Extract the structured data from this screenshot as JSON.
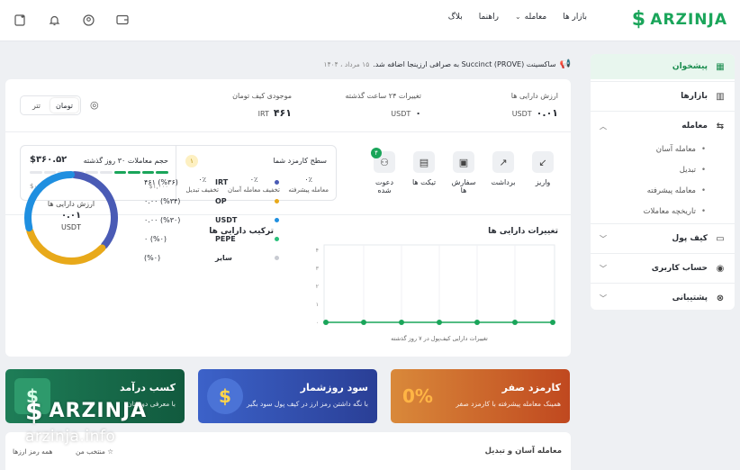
{
  "brand": {
    "name": "ARZINJA",
    "mark": "$",
    "color": "#1aa55a"
  },
  "topnav": {
    "markets": "بازار ها",
    "trade": "معامله",
    "guide": "راهنما",
    "blog": "بلاگ"
  },
  "sidebar": {
    "items": [
      {
        "label": "پیشخوان",
        "icon": "dashboard-icon"
      },
      {
        "label": "بازارها",
        "icon": "chart-bars-icon"
      },
      {
        "label": "معامله",
        "icon": "exchange-icon"
      },
      {
        "label": "کیف پول",
        "icon": "wallet-icon"
      },
      {
        "label": "حساب کاربری",
        "icon": "user-icon"
      },
      {
        "label": "پشتیبانی",
        "icon": "support-icon"
      }
    ],
    "trade_sub": [
      "معامله آسان",
      "تبدیل",
      "معامله پیشرفته",
      "تاریخچه معاملات"
    ]
  },
  "announcement": {
    "text": "ساکسینت (Succinct (PROVE به صرافی ارزینجا اضافه شد.",
    "date": "۱۵ مرداد ، ۱۴۰۴"
  },
  "stats": {
    "asset_value": {
      "label": "ارزش دارایی ها",
      "value": "۰.۰۱",
      "unit": "USDT"
    },
    "change_24h": {
      "label": "تغییرات ۲۴ ساعت گذشته",
      "value": "۰",
      "unit": "USDT"
    },
    "wallet_stock": {
      "label": "موجودی کیف تومان",
      "value": "۴۶۱",
      "unit": "IRT"
    }
  },
  "currency_toggle": {
    "toman": "تومان",
    "tether": "تتر"
  },
  "actions": [
    {
      "label": "واریز",
      "icon": "deposit-icon"
    },
    {
      "label": "برداشت",
      "icon": "withdraw-icon"
    },
    {
      "label": "سفارش ها",
      "icon": "orders-icon"
    },
    {
      "label": "تیکت ها",
      "icon": "ticket-icon"
    },
    {
      "label": "دعوت شده",
      "icon": "invited-users-icon",
      "badge": "۴"
    }
  ],
  "fee_level": {
    "title": "سطح کارمزد شما",
    "level": "۱",
    "cols": [
      {
        "value": "۰٪",
        "label": "معامله پیشرفته"
      },
      {
        "value": "۰٪",
        "label": "تخفیف معامله آسان"
      },
      {
        "value": "۰٪",
        "label": "تخفیف تبدیل"
      }
    ]
  },
  "volume": {
    "title": "حجم معاملات ۳۰ روز گذشته",
    "value": "$۳۶۰.۵۲",
    "min": "$۰",
    "max": "$۱,۰۰۰",
    "progress": 0.36
  },
  "composition": {
    "title": "ترکیب دارایی ها",
    "center_label": "ارزش دارایی ها",
    "center_value": "۰.۰۱",
    "center_unit": "USDT",
    "items": [
      {
        "name": "IRT",
        "pct": "۴۶۱ (%۳۶)",
        "color": "#4a5bb5",
        "share": 36
      },
      {
        "name": "OP",
        "pct": "۰.۰۰ (%۳۴)",
        "color": "#e8a91a",
        "share": 34
      },
      {
        "name": "USDT",
        "pct": "۰.۰۰ (%۳۰)",
        "color": "#1f8fe0",
        "share": 30
      },
      {
        "name": "PEPE",
        "pct": "۰ (%۰)",
        "color": "#28c07a",
        "share": 0
      },
      {
        "name": "سایر",
        "pct": "(%۰)",
        "color": "#c8cbd2",
        "share": 0
      }
    ]
  },
  "chart_data": {
    "type": "line",
    "title": "تغییرات دارایی ها",
    "xlabel": "تغییرات دارایی کیف‌پول در ۷ روز گذشته",
    "ylabel": "",
    "yticks": [
      "۰",
      "۱",
      "۲",
      "۳",
      "۴"
    ],
    "ylim": [
      0,
      4
    ],
    "series": [
      {
        "values": [
          0,
          0,
          0,
          0,
          0,
          0,
          0
        ]
      }
    ],
    "color": "#1aa55a"
  },
  "promos": [
    {
      "title": "کارمزد صفر",
      "sub": "همینک معامله پیشرفته با کارمزد صفر",
      "color": "#c9542a",
      "art": "0%"
    },
    {
      "title": "سود روزشمار",
      "sub": "با نگه داشتن رمز ارز در کیف پول سود بگیر",
      "color": "#2c49a8",
      "art": "$"
    },
    {
      "title": "کسب درآمد",
      "sub": "با معرفی دوستان",
      "color": "#156b4a",
      "art": "$"
    }
  ],
  "bottom": {
    "title": "معامله آسان و تبدیل",
    "link1": "منتخب من",
    "link2": "همه رمز ارزها"
  },
  "watermark": {
    "name": "ARZINJA",
    "url": "arzinja.info"
  }
}
